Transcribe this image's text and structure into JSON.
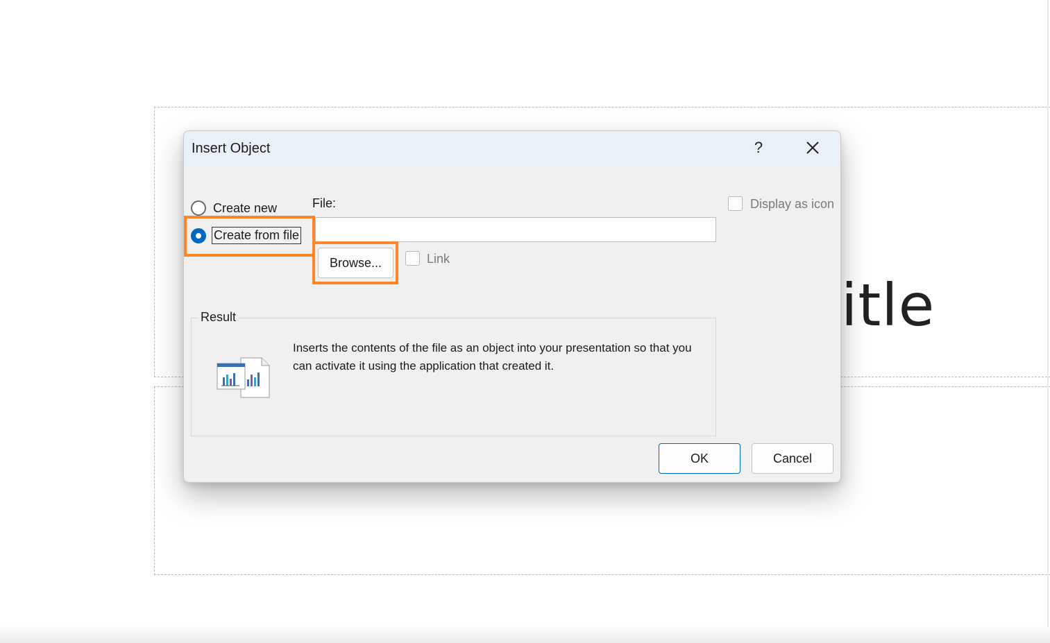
{
  "slide": {
    "title_fragment": "itle"
  },
  "dialog": {
    "title": "Insert Object",
    "help_label": "?",
    "options": {
      "create_new": "Create new",
      "create_from_file": "Create from file",
      "selected": "create_from_file"
    },
    "file": {
      "label": "File:",
      "value": "",
      "browse_label": "Browse...",
      "link_label": "Link",
      "link_checked": false
    },
    "display_as_icon": {
      "label": "Display as icon",
      "checked": false
    },
    "result": {
      "title": "Result",
      "text": "Inserts the contents of the file as an object into your presentation so that you can activate it using the application that created it."
    },
    "buttons": {
      "ok": "OK",
      "cancel": "Cancel"
    }
  },
  "colors": {
    "highlight": "#ff8526",
    "accent": "#0067c0",
    "dialog_bg": "#f0f0f0"
  }
}
